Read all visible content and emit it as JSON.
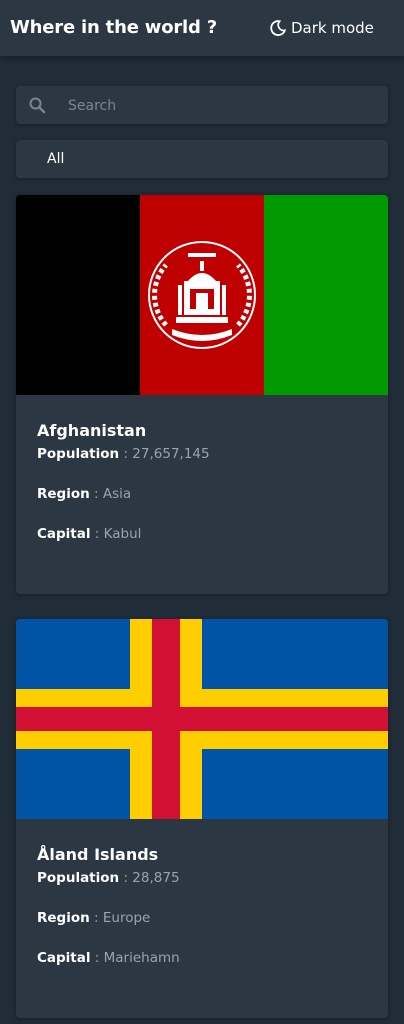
{
  "header": {
    "title": "Where in the world ?",
    "dark_mode_label": "Dark mode",
    "dark_mode_icon": "moon-icon"
  },
  "search": {
    "placeholder": "Search",
    "value": "",
    "icon": "search-icon"
  },
  "filter": {
    "selected": "All"
  },
  "labels": {
    "population": "Population",
    "region": "Region",
    "capital": "Capital",
    "separator": " : "
  },
  "countries": [
    {
      "name": "Afghanistan",
      "population": "27,657,145",
      "region": "Asia",
      "capital": "Kabul",
      "flag_icon": "afghanistan-flag",
      "flag_colors": [
        "#000000",
        "#be0000",
        "#009900"
      ]
    },
    {
      "name": "Åland Islands",
      "population": "28,875",
      "region": "Europe",
      "capital": "Mariehamn",
      "flag_icon": "aland-islands-flag",
      "flag_colors": [
        "#0053a5",
        "#ffce00",
        "#d21034"
      ]
    }
  ],
  "colors": {
    "background": "#202c37",
    "element": "#2b3743",
    "muted_text": "#9aa3ad"
  }
}
